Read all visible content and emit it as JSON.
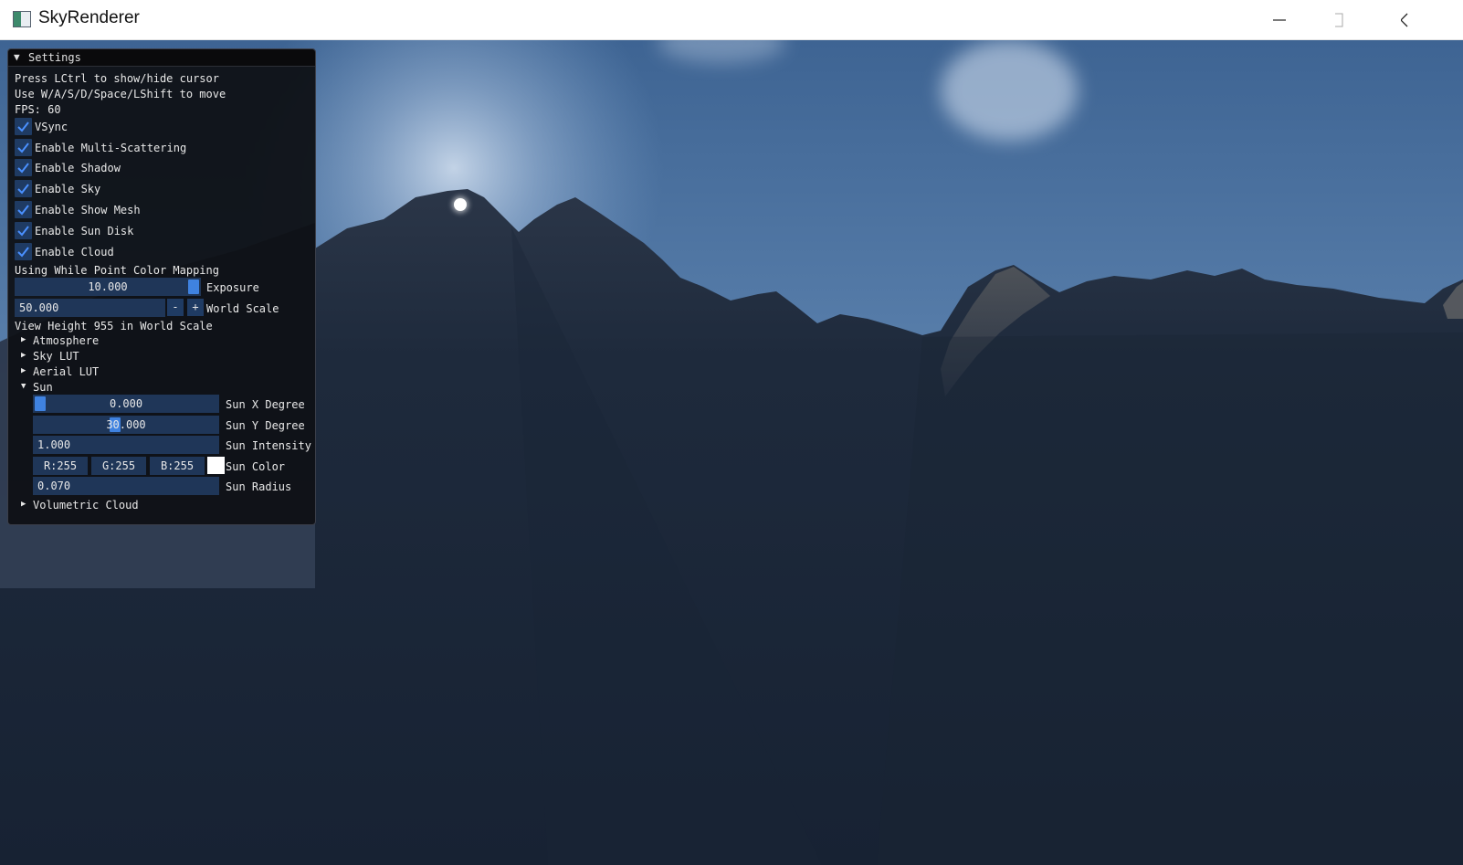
{
  "window": {
    "title": "SkyRenderer",
    "controls": {
      "minimize": "minimize-icon",
      "maximize": "maximize-icon",
      "close": "close-icon"
    }
  },
  "panel": {
    "title": "Settings",
    "help_lines": [
      "Press LCtrl to show/hide cursor",
      "Use W/A/S/D/Space/LShift to move",
      "FPS: 60"
    ],
    "checkboxes": [
      {
        "label": "VSync",
        "checked": true
      },
      {
        "label": "Enable Multi-Scattering",
        "checked": true
      },
      {
        "label": "Enable Shadow",
        "checked": true
      },
      {
        "label": "Enable Sky",
        "checked": true
      },
      {
        "label": "Enable Show Mesh",
        "checked": true
      },
      {
        "label": "Enable Sun Disk",
        "checked": true
      },
      {
        "label": "Enable Cloud",
        "checked": true
      }
    ],
    "mapping_text": "Using While Point Color Mapping",
    "exposure": {
      "value": "10.000",
      "label": "Exposure",
      "fraction": 1.0
    },
    "world_scale": {
      "value": "50.000",
      "label": "World Scale",
      "minus": "-",
      "plus": "+"
    },
    "view_height_text": "View Height 955 in World Scale",
    "tree": [
      {
        "label": "Atmosphere",
        "open": false
      },
      {
        "label": "Sky LUT",
        "open": false
      },
      {
        "label": "Aerial LUT",
        "open": false
      },
      {
        "label": "Sun",
        "open": true
      }
    ],
    "sun": {
      "x_degree": {
        "value": "0.000",
        "label": "Sun X Degree",
        "fraction": 0.0
      },
      "y_degree": {
        "value": "30.000",
        "label": "Sun Y Degree",
        "fraction": 0.42
      },
      "intensity": {
        "value": "1.000",
        "label": "Sun Intensity"
      },
      "color": {
        "r": "R:255",
        "g": "G:255",
        "b": "B:255",
        "label": "Sun Color",
        "swatch": "#ffffff"
      },
      "radius": {
        "value": "0.070",
        "label": "Sun Radius"
      }
    },
    "volumetric_cloud": {
      "label": "Volumetric Cloud",
      "open": false
    }
  },
  "colors": {
    "sky_top": "#3f6594",
    "sky_horizon": "#7ea5cf",
    "mountain": "#1c2738",
    "checkbox_bg": "#1f3b63",
    "accent": "#3f82e0"
  }
}
